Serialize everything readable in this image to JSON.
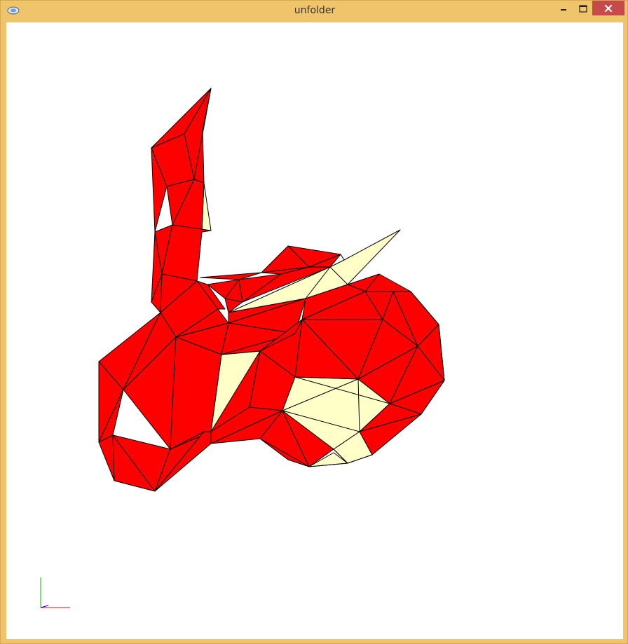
{
  "window": {
    "title": "unfolder",
    "controls": {
      "minimize_icon": "minimize-icon",
      "maximize_icon": "maximize-icon",
      "close_icon": "close-icon"
    }
  },
  "viewport": {
    "background": "#ffffff",
    "model": {
      "front_face_color": "#ff0000",
      "back_face_color": "#ffffc8",
      "edge_color": "#000000"
    },
    "axes": {
      "x_color": "#ff0000",
      "y_color": "#00c000",
      "z_color": "#0000ff"
    }
  }
}
